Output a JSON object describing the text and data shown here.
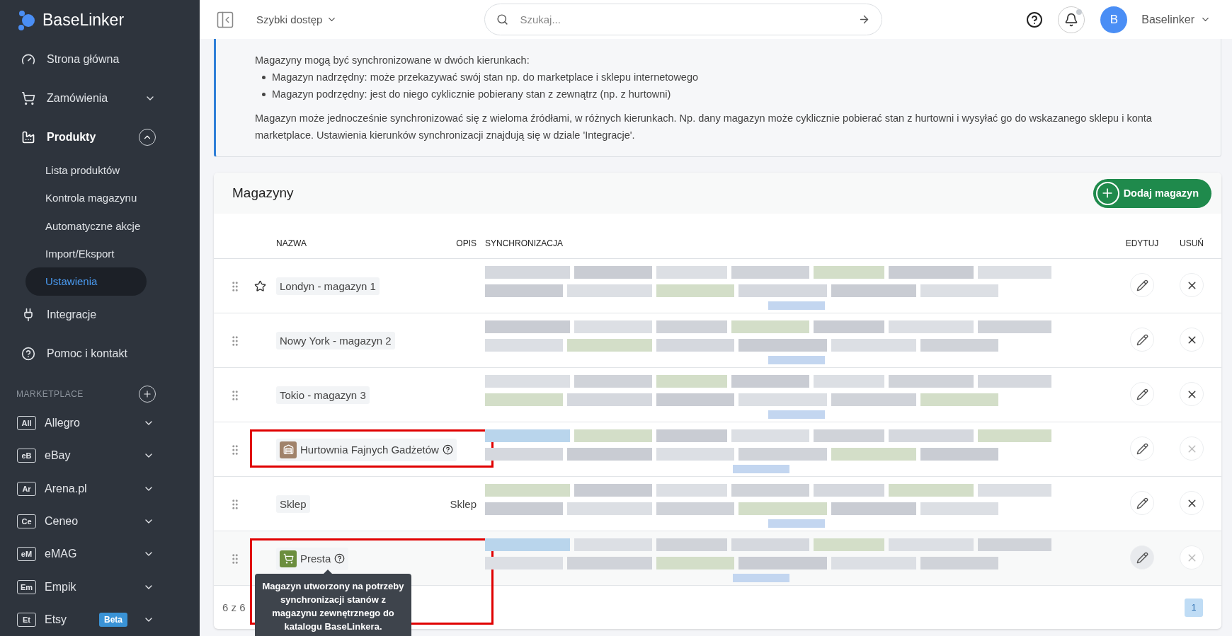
{
  "sidebar": {
    "logo": "BaseLinker",
    "items": [
      {
        "label": "Strona główna",
        "kind": "link"
      },
      {
        "label": "Zamówienia",
        "kind": "group",
        "expanded": false
      },
      {
        "label": "Produkty",
        "kind": "group",
        "expanded": true,
        "children": [
          {
            "label": "Lista produktów",
            "selected": false
          },
          {
            "label": "Kontrola magazynu",
            "selected": false
          },
          {
            "label": "Automatyczne akcje",
            "selected": false
          },
          {
            "label": "Import/Eksport",
            "selected": false
          },
          {
            "label": "Ustawienia",
            "selected": true
          }
        ]
      },
      {
        "label": "Integracje",
        "kind": "link"
      },
      {
        "label": "Pomoc i kontakt",
        "kind": "link"
      }
    ],
    "section_title": "MARKETPLACE",
    "marketplaces": [
      {
        "code": "All",
        "label": "Allegro"
      },
      {
        "code": "eB",
        "label": "eBay"
      },
      {
        "code": "Ar",
        "label": "Arena.pl"
      },
      {
        "code": "Ce",
        "label": "Ceneo"
      },
      {
        "code": "eM",
        "label": "eMAG"
      },
      {
        "code": "Em",
        "label": "Empik"
      },
      {
        "code": "Et",
        "label": "Etsy",
        "badge": "Beta"
      }
    ]
  },
  "topbar": {
    "quick_access": "Szybki dostęp",
    "search": {
      "placeholder": "Szukaj..."
    },
    "notification_dot": true,
    "avatar": "B",
    "user": "Baselinker"
  },
  "info": {
    "intro": "Magazyny mogą być synchronizowane w dwóch kierunkach:",
    "bullets": [
      "Magazyn nadrzędny: może przekazywać swój stan np. do marketplace i sklepu internetowego",
      "Magazyn podrzędny: jest do niego cyklicznie pobierany stan z zewnątrz (np. z hurtowni)"
    ],
    "paragraph": "Magazyn może jednocześnie synchronizować się z wieloma źródłami, w różnych kierunkach. Np. dany magazyn może cyklicznie pobierać stan z hurtowni i wysyłać go do wskazanego sklepu i konta marketplace. Ustawienia kierunków synchronizacji znajdują się w dziale 'Integracje'."
  },
  "warehouses": {
    "title": "Magazyny",
    "add_button": "Dodaj magazyn",
    "columns": [
      "NAZWA",
      "OPIS",
      "SYNCHRONIZACJA",
      "EDYTUJ",
      "USUŃ"
    ],
    "rows": [
      {
        "name": "Londyn - magazyn 1",
        "kind": "local",
        "starred": true,
        "highlighted": false,
        "hovered": false,
        "delete_disabled": false
      },
      {
        "name": "Nowy York - magazyn 2",
        "kind": "local",
        "starred": false,
        "highlighted": false,
        "hovered": false,
        "delete_disabled": false
      },
      {
        "name": "Tokio - magazyn 3",
        "kind": "local",
        "starred": false,
        "highlighted": false,
        "hovered": false,
        "delete_disabled": false
      },
      {
        "name": "Hurtownia Fajnych Gadżetów",
        "kind": "wholesaler",
        "color": "#a0826a",
        "starred": false,
        "highlighted": true,
        "hovered": false,
        "delete_disabled": true
      },
      {
        "name": "Sklep",
        "description": "Sklep",
        "kind": "local",
        "starred": false,
        "highlighted": false,
        "hovered": false,
        "delete_disabled": false
      },
      {
        "name": "Presta",
        "kind": "shop",
        "color": "#6b8e3e",
        "tooltip": "Magazyn utworzony na potrzeby synchronizacji stanów z magazynu zewnętrznego do katalogu BaseLinkera.",
        "starred": false,
        "highlighted": true,
        "hovered": true,
        "delete_disabled": true
      }
    ],
    "count": "6 z 6",
    "page": "1"
  }
}
